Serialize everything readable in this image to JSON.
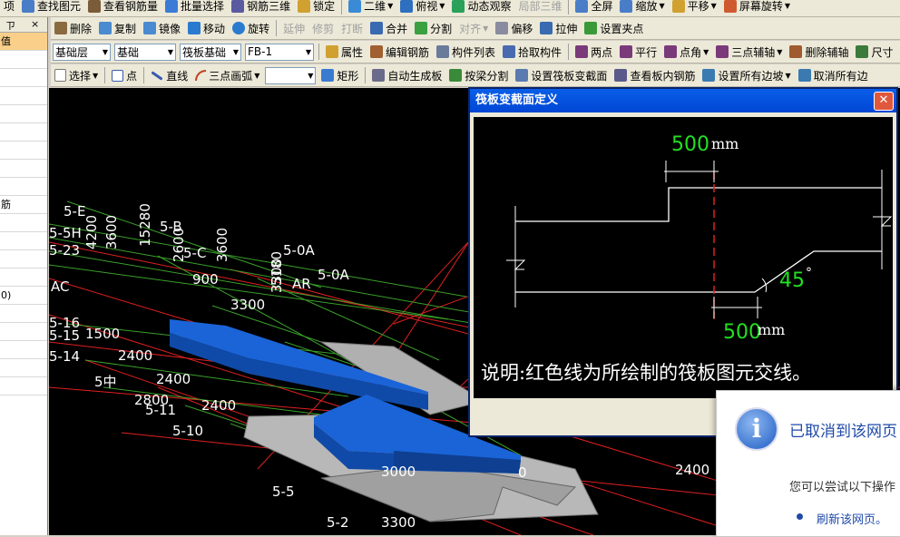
{
  "toolbar1": {
    "items": [
      "项",
      "查找图元",
      "查看钢筋量",
      "批量选择",
      "钢筋三维",
      "锁定",
      "二维",
      "俯视",
      "动态观察",
      "局部三维",
      "全屏",
      "缩放",
      "平移",
      "屏幕旋转"
    ]
  },
  "toolbar2": {
    "delete": "删除",
    "copy": "复制",
    "mirror": "镜像",
    "move": "移动",
    "rotate": "旋转",
    "extend": "延伸",
    "trim": "修剪",
    "break": "打断",
    "merge": "合并",
    "split": "分割",
    "align": "对齐",
    "offset": "偏移",
    "stretch": "拉伸",
    "set_grip": "设置夹点"
  },
  "toolbar3": {
    "layer": "基础层",
    "category": "基础",
    "type": "筏板基础",
    "element": "FB-1",
    "properties": "属性",
    "edit_rebar": "编辑钢筋",
    "component_list": "构件列表",
    "pick_component": "拾取构件",
    "two_points": "两点",
    "parallel": "平行",
    "corner": "点角",
    "three_point_aux": "三点辅轴",
    "delete_aux": "删除辅轴",
    "dimension": "尺寸"
  },
  "toolbar4": {
    "select": "选择",
    "point": "点",
    "line": "直线",
    "arc": "三点画弧",
    "rect": "矩形",
    "auto_gen": "自动生成板",
    "split_beam": "按梁分割",
    "set_section": "设置筏板变截面",
    "view_rebar": "查看板内钢筋",
    "set_edges": "设置所有边坡",
    "cancel_edges": "取消所有边"
  },
  "left_panel": {
    "header_label": "值",
    "pin_glyph": "ㄗ",
    "close_glyph": "×",
    "rows": [
      "",
      "",
      "",
      "",
      "",
      "",
      "",
      "",
      "筋",
      "",
      "",
      "",
      "",
      "0)",
      "",
      "",
      "",
      "",
      ""
    ]
  },
  "canvas": {
    "labels": [
      "5-E",
      "5-5H",
      "5-23",
      "AC",
      "4200",
      "3600",
      "15280",
      "5-B",
      "2600",
      "5-C",
      "3600",
      "5-0A",
      "3300",
      "5180",
      "AR",
      "5-0A",
      "900",
      "3300",
      "5-16",
      "5-15",
      "1500",
      "5-14",
      "2400",
      "2400",
      "2800",
      "5-11",
      "2400",
      "5-10",
      "3000",
      "5-5",
      "5-2",
      "3300",
      "0",
      "5中",
      "2400"
    ]
  },
  "dialog": {
    "title": "筏板变截面定义",
    "close": "✕",
    "dim_top": "500",
    "dim_top_unit": "mm",
    "dim_bottom": "500",
    "dim_bottom_unit": "mm",
    "angle": "45",
    "degree": "°",
    "note": "说明:红色线为所绘制的筏板图元交线。"
  },
  "notification": {
    "icon": "i",
    "title": "已取消到该网页",
    "text": "您可以尝试以下操作",
    "link": "刷新该网页。"
  },
  "colors": {
    "accent_blue": "#1a64d8",
    "canvas_bg": "#000000",
    "red_line": "#e02020",
    "green_line": "#3aa02a",
    "dim_green": "#22e022"
  }
}
